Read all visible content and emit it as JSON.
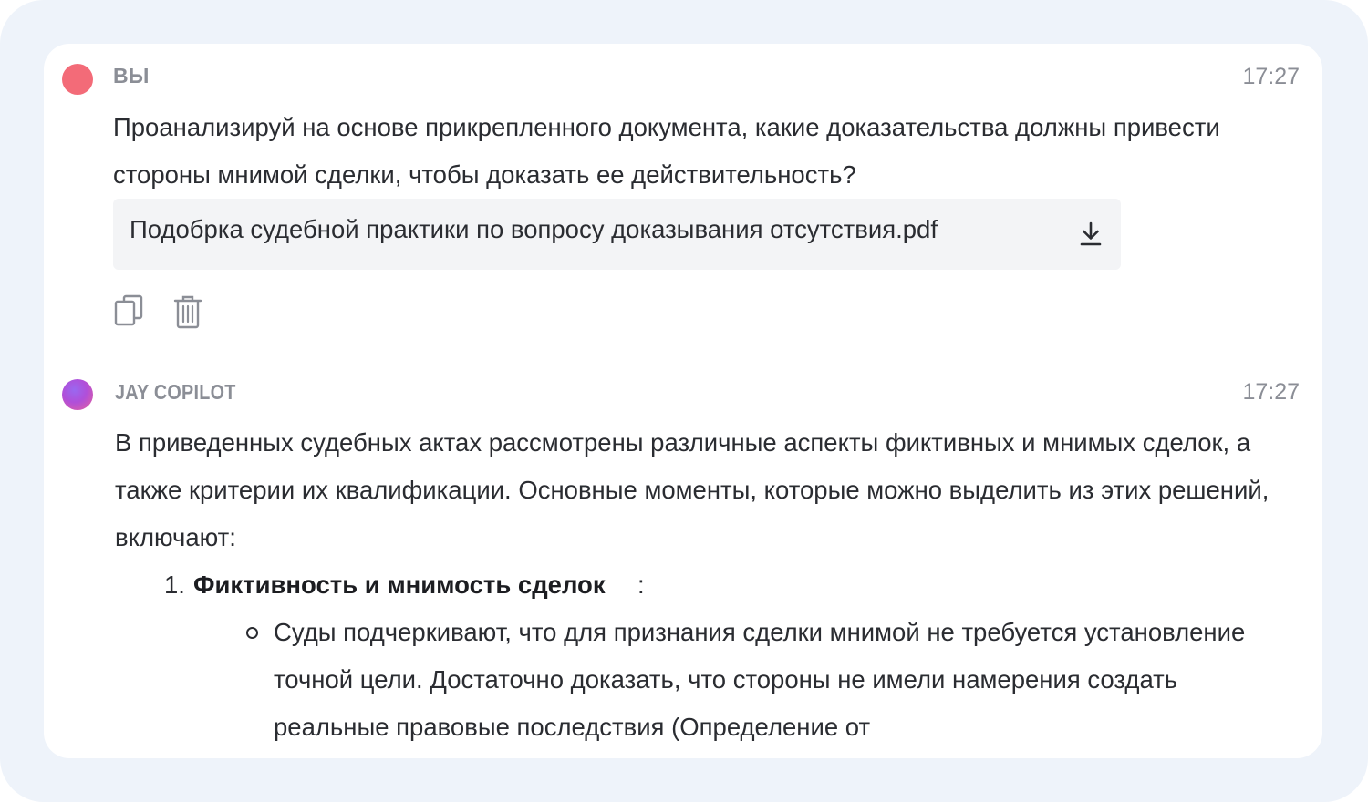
{
  "user_message": {
    "sender": "ВЫ",
    "time": "17:27",
    "text": "Проанализируй на основе прикрепленного документа, какие доказательства должны привести стороны мнимой сделки, чтобы доказать ее действительность?",
    "attachment": {
      "filename": "Подобрка судебной практики по вопросу доказывания отсутствия.pdf",
      "icon": "download-icon"
    },
    "actions": [
      {
        "icon": "copy-icon"
      },
      {
        "icon": "trash-icon"
      }
    ],
    "avatar_color": "#f36b78"
  },
  "bot_message": {
    "sender": "JAY COPILOT",
    "time": "17:27",
    "intro": "В приведенных судебных актах рассмотрены различные аспекты фиктивных и мнимых сделок, а также критерии их квалификации. Основные моменты, которые можно выделить из этих решений, включают:",
    "list": [
      {
        "number": "1.",
        "title": "Фиктивность и мнимость сделок",
        "suffix": ":",
        "sub_items": [
          "Суды подчеркивают, что для признания сделки мнимой не требуется установление точной цели. Достаточно доказать, что стороны не имели намерения создать реальные правовые последствия (Определение от"
        ]
      }
    ]
  }
}
